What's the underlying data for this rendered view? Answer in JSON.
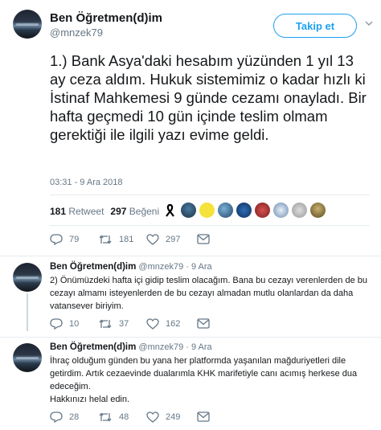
{
  "main_tweet": {
    "author_name": "Ben Öğretmen(d)im",
    "author_handle": "@mnzek79",
    "follow_label": "Takip et",
    "text": "1.) Bank Asya'daki hesabım yüzünden 1 yıl 13 ay ceza aldım. Hukuk sistemimiz o kadar hızlı ki İstinaf Mahkemesi 9 günde cezamı onayladı. Bir hafta geçmedi 10 gün içinde teslim olmam gerektiği ile ilgili yazı evime geldi.",
    "timestamp": "03:31 - 9 Ara 2018",
    "retweet_count": "181",
    "retweet_label": "Retweet",
    "like_count": "297",
    "like_label": "Beğeni",
    "liker_avatars": [
      "ribbon-avatar",
      "avatar-2",
      "avatar-3",
      "avatar-4",
      "avatar-5",
      "avatar-6",
      "avatar-7",
      "avatar-8",
      "avatar-9"
    ],
    "actions": {
      "replies": "79",
      "retweets": "181",
      "likes": "297"
    }
  },
  "replies": [
    {
      "author_name": "Ben Öğretmen(d)im",
      "meta": "@mnzek79 · 9 Ara",
      "text": "2)  Önümüzdeki hafta içi gidip teslim olacağım. Bana bu cezayı verenlerden de bu cezayı almamı isteyenlerden de bu cezayı almadan mutlu olanlardan da daha vatansever biriyim.",
      "actions": {
        "replies": "10",
        "retweets": "37",
        "likes": "162"
      }
    },
    {
      "author_name": "Ben Öğretmen(d)im",
      "meta": "@mnzek79 · 9 Ara",
      "text": "İhraç olduğum günden bu yana her platformda yaşanılan mağduriyetleri dile getirdim. Artık cezaevinde dualarımla KHK marifetiyle canı acımış herkese dua edeceğim.",
      "text2": "Hakkınızı helal edin.",
      "actions": {
        "replies": "28",
        "retweets": "48",
        "likes": "249"
      }
    }
  ],
  "colors": {
    "accent": "#1da1f2",
    "muted": "#657786",
    "text": "#14171a",
    "divider": "#e6ecf0"
  }
}
